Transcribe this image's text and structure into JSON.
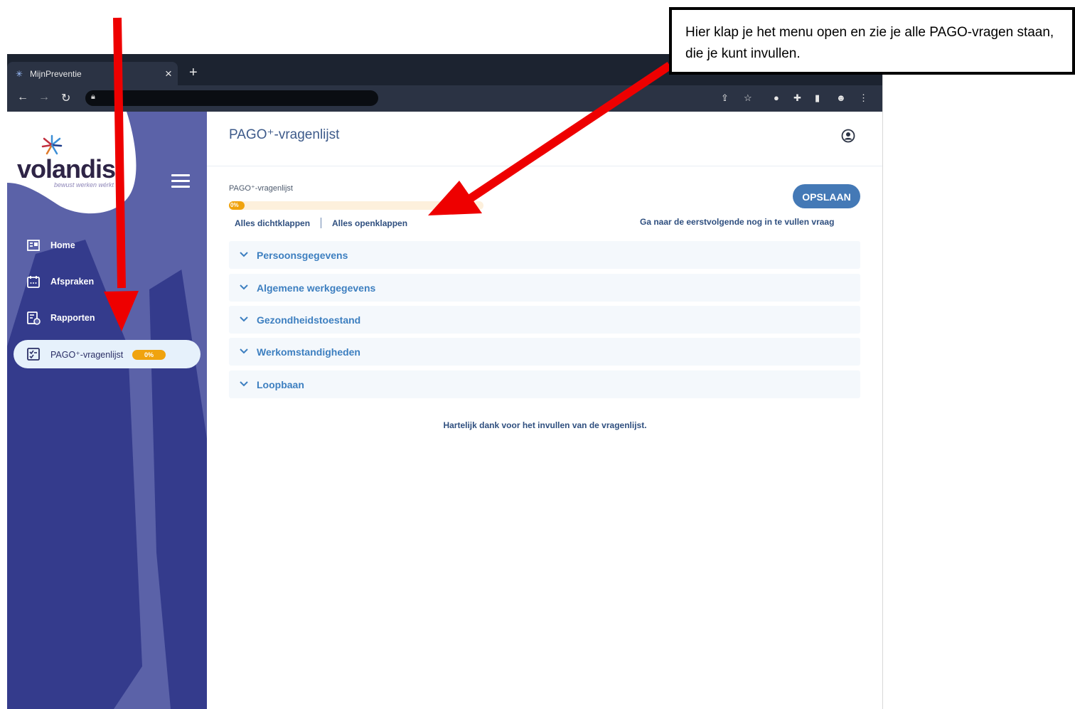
{
  "browser": {
    "tab_title": "MijnPreventie",
    "tab_close": "×",
    "new_tab": "+"
  },
  "sidebar": {
    "logo_text": "volandis",
    "logo_tagline": "bewust werken wérkt",
    "items": [
      {
        "label": "Home",
        "icon": "home-icon"
      },
      {
        "label": "Afspraken",
        "icon": "calendar-icon"
      },
      {
        "label": "Rapporten",
        "icon": "report-icon"
      },
      {
        "label": "PAGO⁺-vragenlijst",
        "icon": "checklist-icon",
        "badge": "0%",
        "active": true
      }
    ]
  },
  "main": {
    "title": "PAGO⁺-vragenlijst",
    "progress_label": "PAGO⁺-vragenlijst",
    "progress_text": "0%",
    "progress_value": 0,
    "collapse_all": "Alles dichtklappen",
    "expand_all": "Alles openklappen",
    "save_label": "OPSLAAN",
    "goto_next": "Ga naar de eerstvolgende nog in te vullen vraag",
    "sections": [
      "Persoonsgegevens",
      "Algemene werkgegevens",
      "Gezondheidstoestand",
      "Werkomstandigheden",
      "Loopbaan"
    ],
    "thanks": "Hartelijk dank voor het invullen van de vragenlijst."
  },
  "annotation": {
    "callout_text": "Hier klap je het menu open en zie je alle PAGO-vragen staan, die je kunt invullen.",
    "arrow_color": "#ee0000"
  },
  "colors": {
    "sidebar": "#5b62a8",
    "sidebar_dark": "#343b8c",
    "accent": "#4479b6",
    "badge": "#f0a30e"
  }
}
